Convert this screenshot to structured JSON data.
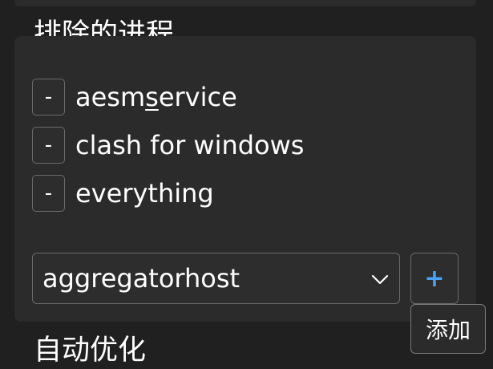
{
  "exclude_section": {
    "title": "排除的进程",
    "remove_label": "-",
    "processes": [
      {
        "prefix": "aesm",
        "underlined": "s",
        "suffix": "ervice"
      },
      {
        "prefix": "clash for windows",
        "underlined": "",
        "suffix": ""
      },
      {
        "prefix": "everything",
        "underlined": "",
        "suffix": ""
      }
    ],
    "select_value": "aggregatorhost",
    "add_label": "+",
    "add_tooltip": "添加"
  },
  "next_section": {
    "title": "自动优化"
  },
  "icons": {
    "dropdown": "chevron-down-icon",
    "add": "plus-icon",
    "remove": "minus-icon"
  },
  "colors": {
    "background": "#202020",
    "panel": "#2b2b2b",
    "accent": "#4aa3f0"
  }
}
